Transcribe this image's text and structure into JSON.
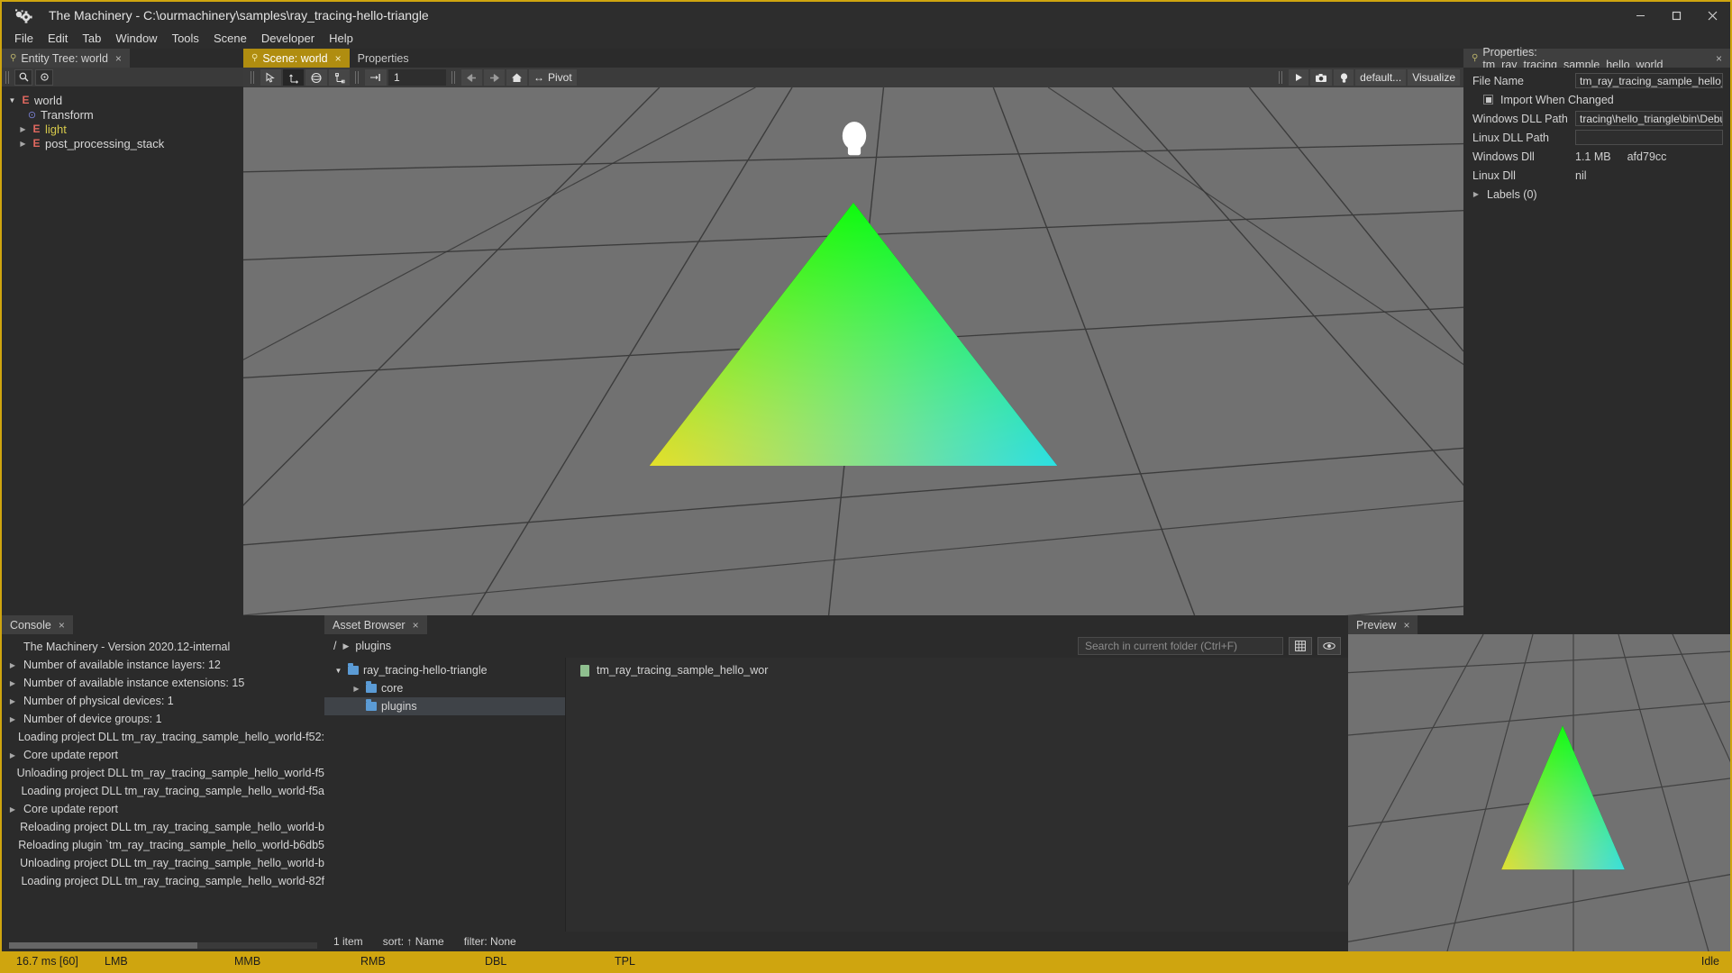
{
  "window": {
    "title": "The Machinery - C:\\ourmachinery\\samples\\ray_tracing-hello-triangle",
    "logo_icon": "machinery-logo-icon",
    "minimize_icon": "minimize-icon",
    "maximize_icon": "maximize-icon",
    "close_icon": "close-icon"
  },
  "menu": {
    "items": [
      {
        "label": "File"
      },
      {
        "label": "Edit"
      },
      {
        "label": "Tab"
      },
      {
        "label": "Window"
      },
      {
        "label": "Tools"
      },
      {
        "label": "Scene"
      },
      {
        "label": "Developer"
      },
      {
        "label": "Help"
      }
    ]
  },
  "entity_tree": {
    "tab_label": "Entity Tree: world",
    "tab_close": "×",
    "pin_icon": "pin-icon",
    "toolbar": {
      "search_icon": "search-icon",
      "target_icon": "target-icon"
    },
    "nodes": [
      {
        "caret": "▼",
        "icon": "entity-icon",
        "icon_glyph": "E",
        "label": "world",
        "indent": 0,
        "color": "normal"
      },
      {
        "caret": "",
        "icon": "transform-component-icon",
        "icon_glyph": "⊙",
        "label": "Transform",
        "indent": 1,
        "color": "normal"
      },
      {
        "caret": "▶",
        "icon": "entity-icon",
        "icon_glyph": "E",
        "label": "light",
        "indent": 1,
        "color": "yellow"
      },
      {
        "caret": "▶",
        "icon": "entity-icon",
        "icon_glyph": "E",
        "label": "post_processing_stack",
        "indent": 1,
        "color": "normal"
      }
    ]
  },
  "scene": {
    "tabs": [
      {
        "label": "Scene: world",
        "active": true,
        "closable": true,
        "pin_icon": "pin-icon"
      },
      {
        "label": "Properties",
        "active": false,
        "closable": false
      }
    ],
    "toolbar": {
      "select_icon": "select-arrow-icon",
      "move_icon": "move-gizmo-icon",
      "rotate_icon": "rotate-gizmo-icon",
      "scale_icon": "scale-gizmo-icon",
      "snap_icon": "snap-icon",
      "snap_value": "1",
      "back_icon": "arrow-left-icon",
      "forward_icon": "arrow-right-icon",
      "home_icon": "home-icon",
      "pivot_icon": "pivot-icon",
      "pivot_label": "Pivot",
      "play_icon": "play-icon",
      "camera_icon": "camera-icon",
      "light_icon": "light-bulb-icon",
      "camera_preset_label": "default...",
      "visualize_label": "Visualize"
    },
    "light_gizmo_icon": "light-bulb-gizmo-icon"
  },
  "properties": {
    "tab_label": "Properties: tm_ray_tracing_sample_hello_world",
    "tab_close": "×",
    "pin_icon": "pin-icon",
    "fields": [
      {
        "label": "File Name",
        "value": "tm_ray_tracing_sample_hello_wo",
        "type": "input"
      },
      {
        "label": "Windows DLL Path",
        "value": "tracing\\hello_triangle\\bin\\Debug\\",
        "type": "input"
      },
      {
        "label": "Linux DLL Path",
        "value": "",
        "type": "input"
      }
    ],
    "checkbox": {
      "label": "Import When Changed",
      "checked": true
    },
    "readonly": [
      {
        "label": "Windows Dll",
        "value_a": "1.1 MB",
        "value_b": "afd79cc"
      },
      {
        "label": "Linux Dll",
        "value_a": "nil",
        "value_b": ""
      }
    ],
    "labels_section": {
      "caret": "▶",
      "label": "Labels (0)"
    }
  },
  "console": {
    "tab_label": "Console",
    "tab_close": "×",
    "lines": [
      {
        "expandable": false,
        "text": "The Machinery - Version 2020.12-internal"
      },
      {
        "expandable": true,
        "text": "Number of available instance layers: 12"
      },
      {
        "expandable": true,
        "text": "Number of available instance extensions: 15"
      },
      {
        "expandable": true,
        "text": "Number of physical devices: 1"
      },
      {
        "expandable": true,
        "text": "Number of device groups: 1"
      },
      {
        "expandable": false,
        "text": "Loading project DLL tm_ray_tracing_sample_hello_world-f52:"
      },
      {
        "expandable": true,
        "text": "Core update report"
      },
      {
        "expandable": false,
        "text": "Unloading project DLL tm_ray_tracing_sample_hello_world-f5"
      },
      {
        "expandable": false,
        "text": "Loading project DLL tm_ray_tracing_sample_hello_world-f5a"
      },
      {
        "expandable": true,
        "text": "Core update report"
      },
      {
        "expandable": false,
        "text": "Reloading project DLL tm_ray_tracing_sample_hello_world-b"
      },
      {
        "expandable": false,
        "text": "Reloading plugin `tm_ray_tracing_sample_hello_world-b6db5"
      },
      {
        "expandable": false,
        "text": "Unloading project DLL tm_ray_tracing_sample_hello_world-b"
      },
      {
        "expandable": false,
        "text": "Loading project DLL tm_ray_tracing_sample_hello_world-82f"
      }
    ]
  },
  "asset_browser": {
    "tab_label": "Asset Browser",
    "tab_close": "×",
    "breadcrumb": [
      "/",
      "▶",
      "plugins"
    ],
    "search": {
      "placeholder": "Search in current folder (Ctrl+F)",
      "value": "",
      "icon": "search-input"
    },
    "grid_view_icon": "grid-view-icon",
    "eye_icon": "eye-icon",
    "tree": [
      {
        "caret": "▼",
        "label": "ray_tracing-hello-triangle",
        "indent": 0,
        "selected": false
      },
      {
        "caret": "▶",
        "label": "core",
        "indent": 1,
        "selected": false
      },
      {
        "caret": "",
        "label": "plugins",
        "indent": 1,
        "selected": true
      }
    ],
    "items": [
      {
        "label": "tm_ray_tracing_sample_hello_wor",
        "icon": "asset-file-icon"
      }
    ],
    "status": {
      "count": "1 item",
      "sort": "sort: ↑ Name",
      "filter": "filter: None"
    }
  },
  "preview": {
    "tab_label": "Preview",
    "tab_close": "×"
  },
  "statusbar": {
    "frame_time": "16.7 ms [60]",
    "lmb": "LMB",
    "mmb": "MMB",
    "rmb": "RMB",
    "dbl": "DBL",
    "tpl": "TPL",
    "state": "Idle"
  },
  "colors": {
    "accent": "#cfa50f",
    "tab_active": "#b08d10",
    "entity_icon": "#e0685f",
    "component_icon": "#7b82d6",
    "folder": "#5b9bd5",
    "asset_file": "#8fbf8f",
    "viewport_bg": "#6c6c6c",
    "triangle_top": "#00e000",
    "triangle_left": "#ff0000",
    "triangle_right": "#0000ff"
  }
}
